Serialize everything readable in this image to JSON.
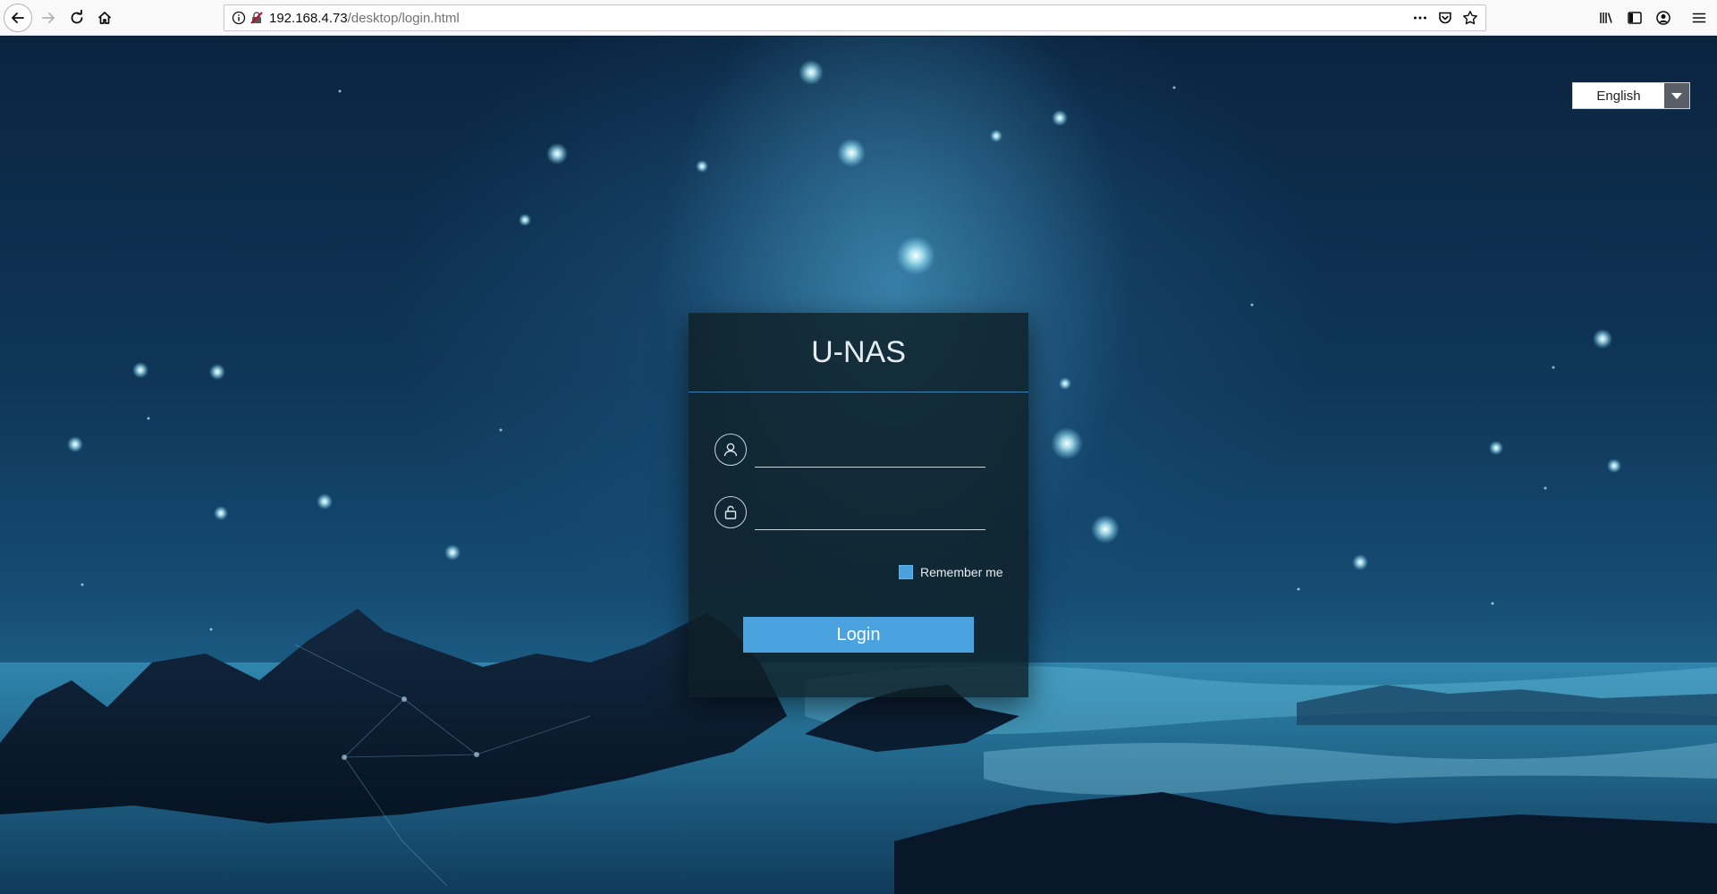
{
  "browser": {
    "url_host": "192.168.4.73",
    "url_path": "/desktop/login.html",
    "icons": {
      "back": "back-arrow-icon",
      "forward": "forward-arrow-icon",
      "reload": "reload-icon",
      "home": "home-icon",
      "info": "info-icon",
      "insecure": "insecure-connection-icon",
      "page_actions": "more-actions-icon",
      "pocket": "pocket-icon",
      "bookmark": "bookmark-star-icon",
      "library": "library-icon",
      "sidebar": "sidebar-icon",
      "account": "account-icon",
      "menu": "hamburger-menu-icon"
    }
  },
  "language": {
    "selected": "English",
    "icon": "chevron-down-icon"
  },
  "login": {
    "title": "U-NAS",
    "username_value": "",
    "password_value": "",
    "username_icon": "user-icon",
    "password_icon": "lock-icon",
    "remember_label": "Remember me",
    "remember_checked": true,
    "login_label": "Login"
  },
  "colors": {
    "accent": "#4aa3df",
    "panel_bg": "#0f1e26",
    "divider": "#3b82b5"
  }
}
